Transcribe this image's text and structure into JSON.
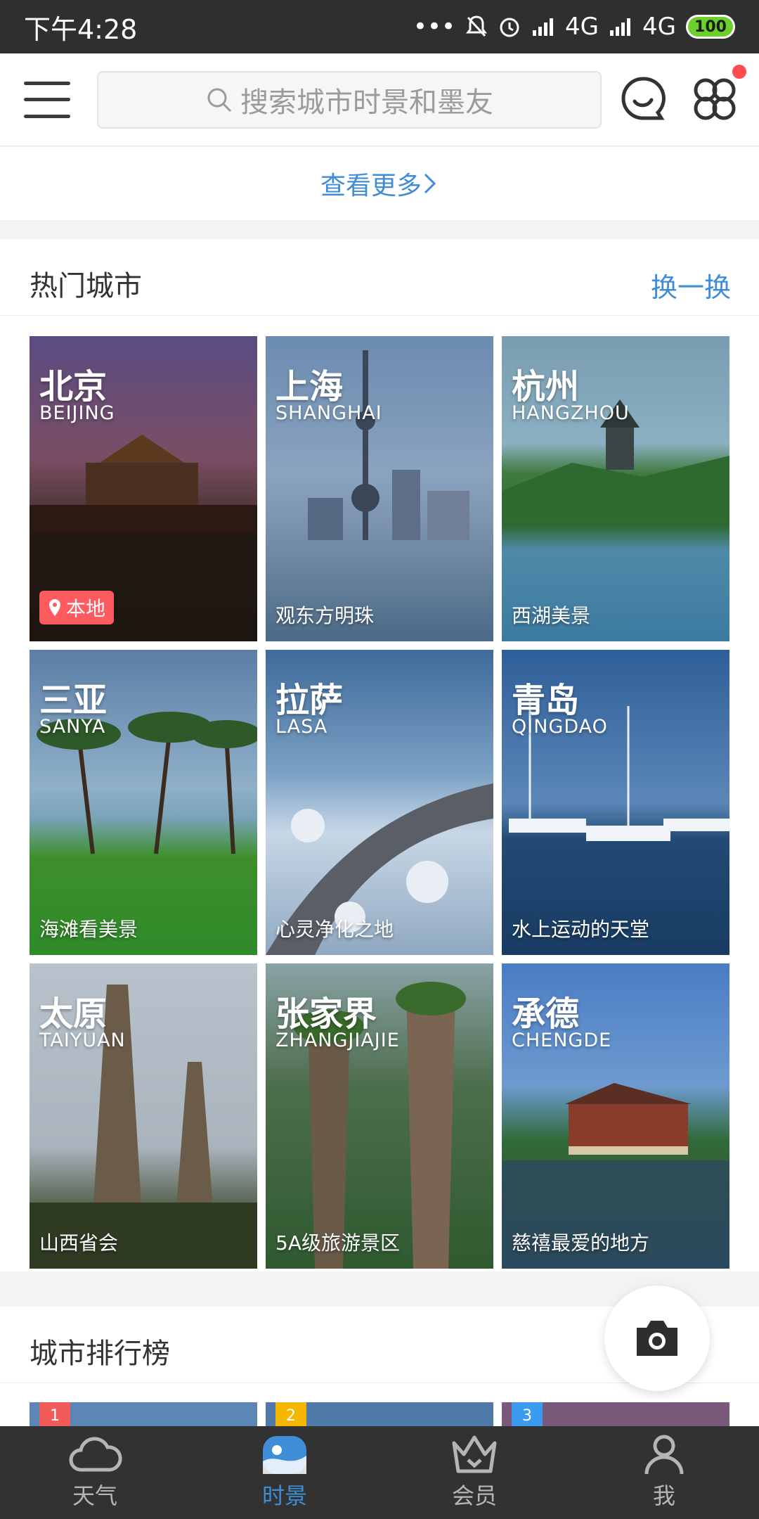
{
  "status_bar": {
    "time": "下午4:28",
    "signal1": "4G",
    "signal2": "4G",
    "battery": "100"
  },
  "search": {
    "placeholder": "搜索城市时景和墨友"
  },
  "see_more": "查看更多",
  "hot_cities": {
    "title": "热门城市",
    "refresh": "换一换",
    "cities": [
      {
        "cn": "北京",
        "en": "BEIJING",
        "caption": "本地",
        "is_local": true
      },
      {
        "cn": "上海",
        "en": "SHANGHAI",
        "caption": "观东方明珠"
      },
      {
        "cn": "杭州",
        "en": "HANGZHOU",
        "caption": "西湖美景"
      },
      {
        "cn": "三亚",
        "en": "SANYA",
        "caption": "海滩看美景"
      },
      {
        "cn": "拉萨",
        "en": "LASA",
        "caption": "心灵净化之地"
      },
      {
        "cn": "青岛",
        "en": "QINGDAO",
        "caption": "水上运动的天堂"
      },
      {
        "cn": "太原",
        "en": "TAIYUAN",
        "caption": "山西省会"
      },
      {
        "cn": "张家界",
        "en": "ZHANGJIAJIE",
        "caption": "5A级旅游景区"
      },
      {
        "cn": "承德",
        "en": "CHENGDE",
        "caption": "慈禧最爱的地方"
      }
    ]
  },
  "ranking": {
    "title": "城市排行榜",
    "ranks": [
      "1",
      "2",
      "3"
    ],
    "rank_colors": [
      "#f35b5b",
      "#f5b600",
      "#3a9bf0"
    ]
  },
  "bottom_nav": [
    {
      "label": "天气",
      "icon": "cloud-icon"
    },
    {
      "label": "时景",
      "icon": "scenery-icon",
      "active": true
    },
    {
      "label": "会员",
      "icon": "crown-icon"
    },
    {
      "label": "我",
      "icon": "person-icon"
    }
  ],
  "colors": {
    "accent": "#3f8dd6",
    "local_badge": "#ff5a5f"
  }
}
